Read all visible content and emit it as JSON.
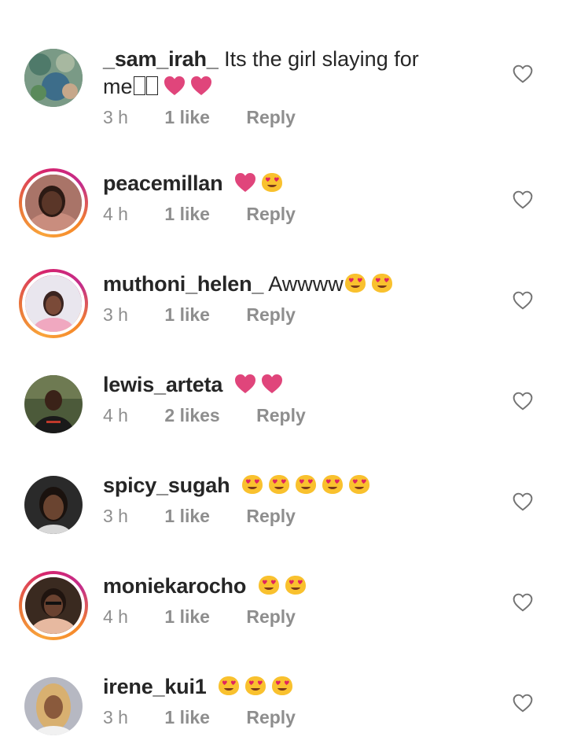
{
  "comments": [
    {
      "username": "_sam_irah_",
      "text": "Its the girl slaying for",
      "text2": "me",
      "emojis": [
        "heart",
        "heart"
      ],
      "time": "3 h",
      "likes": "1 like",
      "reply": "Reply",
      "story_ring": false
    },
    {
      "username": "peacemillan",
      "text": "",
      "emojis": [
        "heart",
        "heart-eyes"
      ],
      "time": "4 h",
      "likes": "1 like",
      "reply": "Reply",
      "story_ring": true
    },
    {
      "username": "muthoni_helen_",
      "text": "Awwww",
      "emojis": [
        "heart-eyes",
        "heart-eyes"
      ],
      "time": "3 h",
      "likes": "1 like",
      "reply": "Reply",
      "story_ring": true
    },
    {
      "username": "lewis_arteta",
      "text": "",
      "emojis": [
        "heart",
        "heart"
      ],
      "time": "4 h",
      "likes": "2 likes",
      "reply": "Reply",
      "story_ring": false
    },
    {
      "username": "spicy_sugah",
      "text": "",
      "emojis": [
        "heart-eyes",
        "heart-eyes",
        "heart-eyes",
        "heart-eyes",
        "heart-eyes"
      ],
      "time": "3 h",
      "likes": "1 like",
      "reply": "Reply",
      "story_ring": false
    },
    {
      "username": "moniekarocho",
      "text": "",
      "emojis": [
        "heart-eyes",
        "heart-eyes"
      ],
      "time": "4 h",
      "likes": "1 like",
      "reply": "Reply",
      "story_ring": true
    },
    {
      "username": "irene_kui1",
      "text": "",
      "emojis": [
        "heart-eyes",
        "heart-eyes",
        "heart-eyes"
      ],
      "time": "3 h",
      "likes": "1 like",
      "reply": "Reply",
      "story_ring": false
    }
  ],
  "colors": {
    "username": "#262626",
    "meta": "#8e8e8e",
    "heart_emoji": "#e0457b",
    "face_emoji": "#f9c12e",
    "story_ring_start": "#f9a43a",
    "story_ring_end": "#d6246e"
  },
  "icons": {
    "like": "heart-outline-icon",
    "heart_emoji": "heart-emoji-icon",
    "heart_eyes_emoji": "heart-eyes-emoji-icon"
  }
}
